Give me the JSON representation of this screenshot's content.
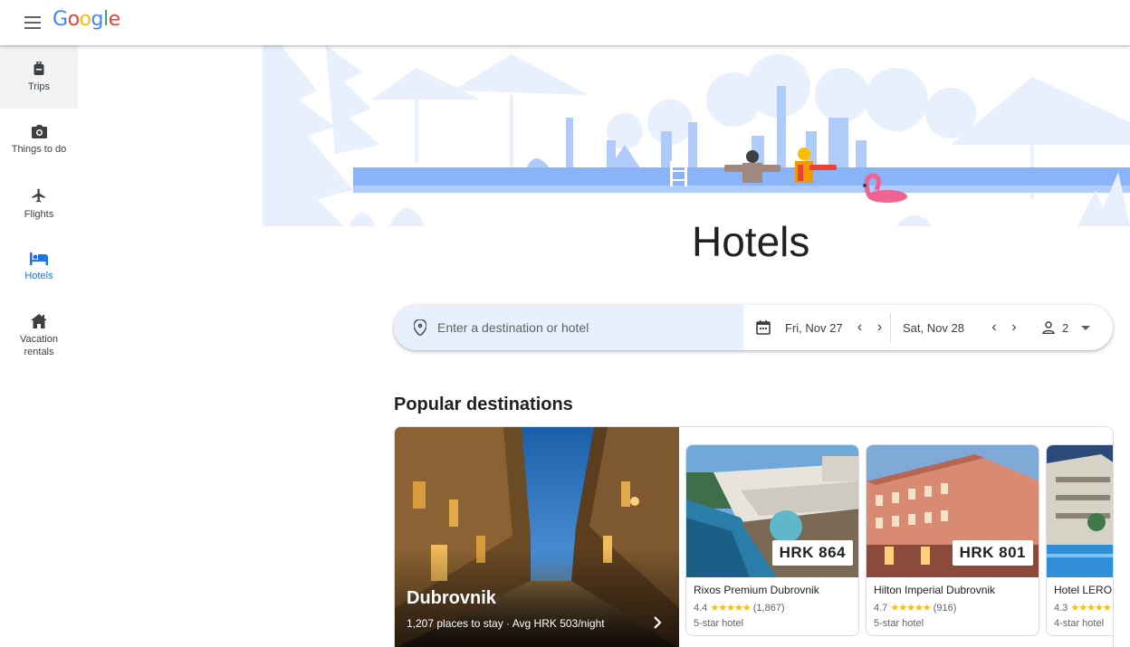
{
  "app": {
    "logo": [
      "G",
      "o",
      "o",
      "g",
      "l",
      "e"
    ],
    "logo_colors": [
      "#4285f4",
      "#ea4335",
      "#fbbc05",
      "#4285f4",
      "#34a853",
      "#ea4335"
    ]
  },
  "sidebar": {
    "items": [
      {
        "label": "Trips",
        "icon": "luggage-icon",
        "active": true
      },
      {
        "label": "Things to do",
        "icon": "camera-icon"
      },
      {
        "label": "Flights",
        "icon": "airplane-icon"
      },
      {
        "label": "Hotels",
        "icon": "bed-icon",
        "selected": true
      },
      {
        "label": "Vacation rentals",
        "icon": "house-icon"
      }
    ]
  },
  "page": {
    "title": "Hotels"
  },
  "search": {
    "placeholder": "Enter a destination or hotel",
    "check_in": "Fri, Nov 27",
    "check_out": "Sat, Nov 28",
    "guests": "2"
  },
  "popular": {
    "title": "Popular destinations",
    "featured": {
      "name": "Dubrovnik",
      "subtitle": "1,207 places to stay · Avg HRK 503/night"
    },
    "hotels": [
      {
        "name": "Rixos Premium Dubrovnik",
        "price": "HRK 864",
        "rating": "4.4",
        "stars": "★★★★★",
        "reviews": "(1,867)",
        "class": "5-star hotel"
      },
      {
        "name": "Hilton Imperial Dubrovnik",
        "price": "HRK 801",
        "rating": "4.7",
        "stars": "★★★★★",
        "reviews": "(916)",
        "class": "5-star hotel"
      },
      {
        "name": "Hotel LERO",
        "price": "",
        "rating": "4.3",
        "stars": "★★★★★",
        "reviews": "",
        "class": "4-star hotel"
      }
    ]
  },
  "colors": {
    "accent": "#1a73e8",
    "search_bg": "#e8f0fe",
    "hero_light": "#e8f0fe",
    "hero_mid": "#aecbfa",
    "pool": "#8ab4f8",
    "star": "#fbbc04"
  }
}
